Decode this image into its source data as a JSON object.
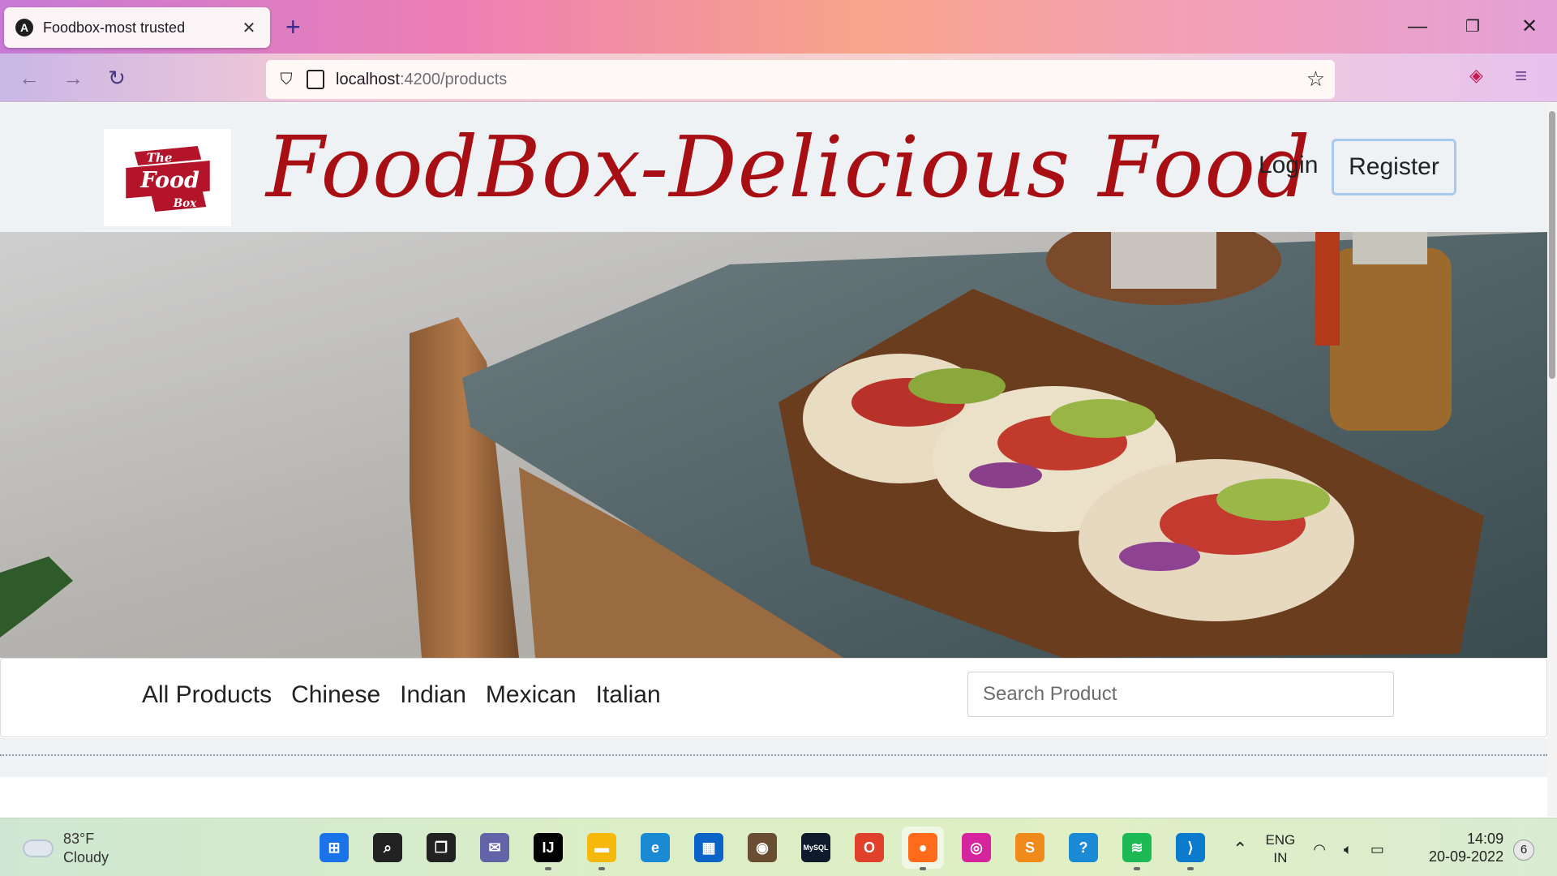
{
  "browser": {
    "tab_title": "Foodbox-most trusted",
    "tab_favicon": "A",
    "url_host": "localhost",
    "url_rest": ":4200/products",
    "new_tab": "+",
    "close_tab": "✕",
    "window_controls": {
      "minimize": "—",
      "restore": "❐",
      "close": "✕"
    }
  },
  "header": {
    "logo": {
      "line1": "The",
      "line2": "Food",
      "line3": "Box"
    },
    "title": "FoodBox-Delicious Food",
    "login": "Login",
    "register": "Register"
  },
  "categories": [
    "All Products",
    "Chinese",
    "Indian",
    "Mexican",
    "Italian"
  ],
  "search": {
    "placeholder": "Search Product",
    "value": ""
  },
  "taskbar": {
    "weather_temp": "83°F",
    "weather_desc": "Cloudy",
    "apps": [
      {
        "name": "start-icon",
        "label": "⊞",
        "color": "#1a73e8"
      },
      {
        "name": "search-icon",
        "label": "⌕",
        "color": "#222222"
      },
      {
        "name": "task-view-icon",
        "label": "❐",
        "color": "#222222"
      },
      {
        "name": "teams-chat-icon",
        "label": "✉",
        "color": "#6264a7"
      },
      {
        "name": "intellij-icon",
        "label": "IJ",
        "color": "#000000"
      },
      {
        "name": "file-explorer-icon",
        "label": "▬",
        "color": "#f6b90b"
      },
      {
        "name": "edge-icon",
        "label": "e",
        "color": "#1a8ad4"
      },
      {
        "name": "store-icon",
        "label": "▦",
        "color": "#0a64c8"
      },
      {
        "name": "github-desktop-icon",
        "label": "◉",
        "color": "#6a4e31"
      },
      {
        "name": "mysql-icon",
        "label": "MySQL",
        "color": "#0f1b2a"
      },
      {
        "name": "office-icon",
        "label": "O",
        "color": "#e0412a"
      },
      {
        "name": "firefox-icon",
        "label": "●",
        "color": "#ff6b1a"
      },
      {
        "name": "instagram-icon",
        "label": "◎",
        "color": "#d6249f"
      },
      {
        "name": "sublime-icon",
        "label": "S",
        "color": "#f08a1a"
      },
      {
        "name": "help-icon",
        "label": "?",
        "color": "#1a8ad4"
      },
      {
        "name": "spotify-icon",
        "label": "≋",
        "color": "#1db954"
      },
      {
        "name": "vscode-icon",
        "label": "⟩",
        "color": "#0a7acc"
      }
    ],
    "lang_top": "ENG",
    "lang_bottom": "IN",
    "time": "14:09",
    "date": "20-09-2022",
    "notifications": "6"
  },
  "colors": {
    "brand_red": "#a80f14",
    "accent_border": "#a8c8ec"
  }
}
